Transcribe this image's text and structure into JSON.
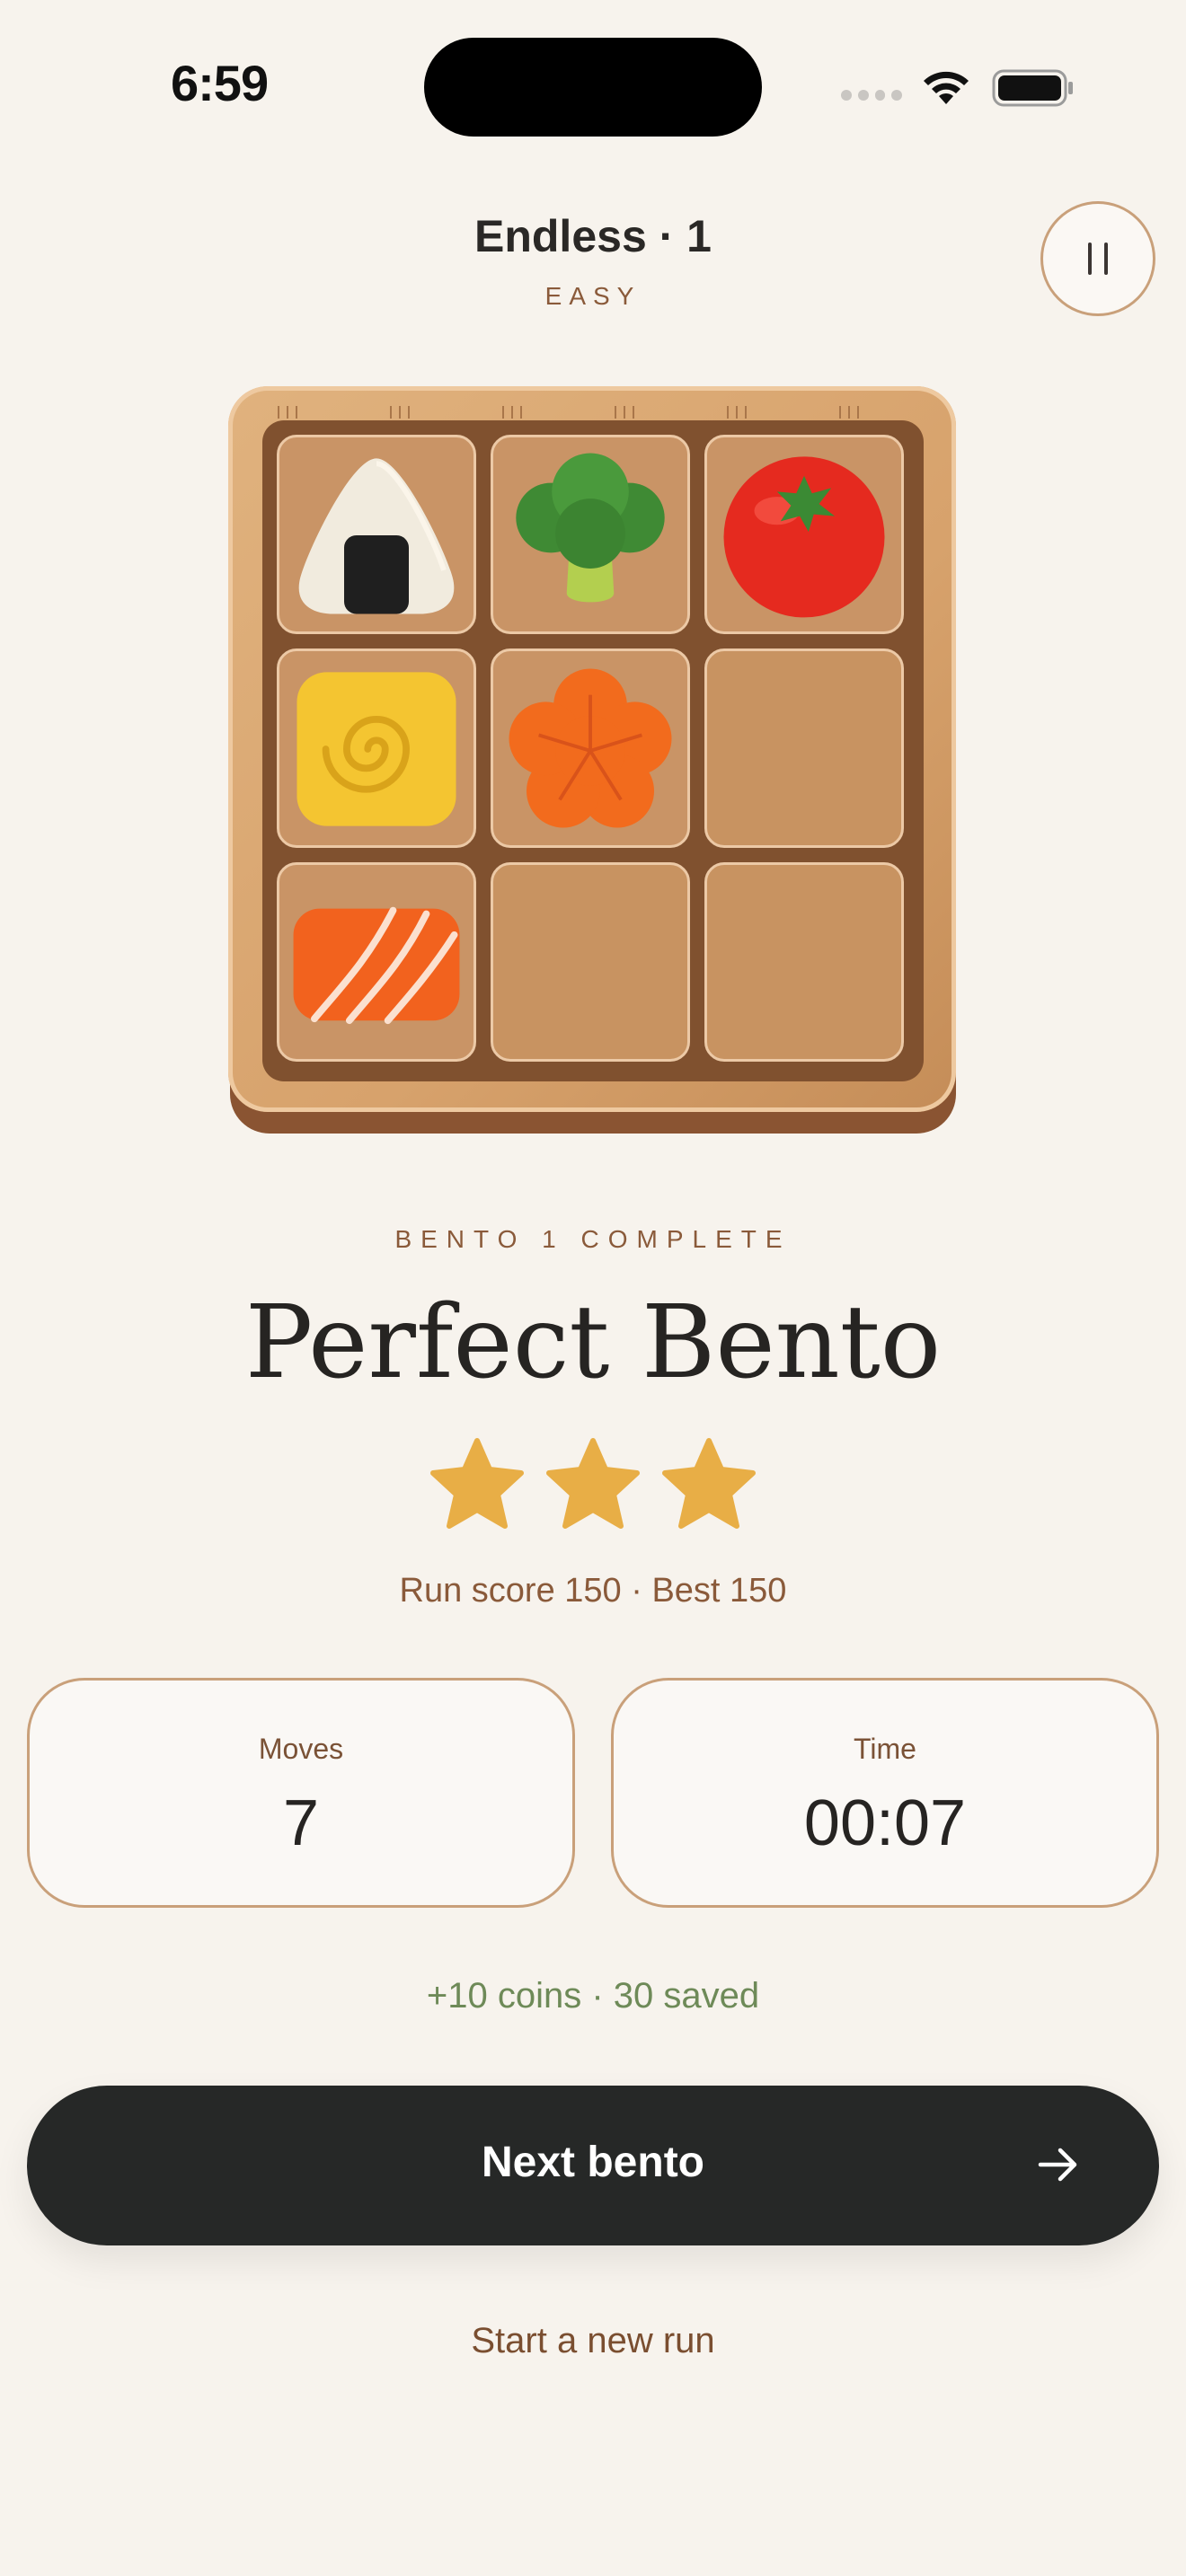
{
  "status_bar": {
    "time": "6:59",
    "icons": [
      "signal-icon",
      "wifi-icon",
      "battery-icon"
    ]
  },
  "header": {
    "title": "Endless · 1",
    "difficulty": "EASY",
    "pause_icon": "pause-icon"
  },
  "bento": {
    "rows": 3,
    "cols": 3,
    "cells": [
      "onigiri",
      "broccoli",
      "tomato",
      "tamagoyaki",
      "carrot-flower",
      "empty",
      "salmon",
      "empty",
      "empty"
    ]
  },
  "result": {
    "eyebrow": "BENTO 1 COMPLETE",
    "headline": "Perfect Bento",
    "stars_earned": 3,
    "stars_total": 3,
    "star_color": "#e8ae46",
    "score_line": "Run score 150 · Best 150"
  },
  "stats": {
    "moves_label": "Moves",
    "moves_value": "7",
    "time_label": "Time",
    "time_value": "00:07"
  },
  "rewards": {
    "line": "+10 coins · 30 saved"
  },
  "actions": {
    "next_label": "Next bento",
    "new_run_label": "Start a new run"
  },
  "colors": {
    "background": "#f7f3ed",
    "accent_brown": "#8a5a3a",
    "reward_green": "#6e8a58",
    "button_dark": "#262827"
  }
}
